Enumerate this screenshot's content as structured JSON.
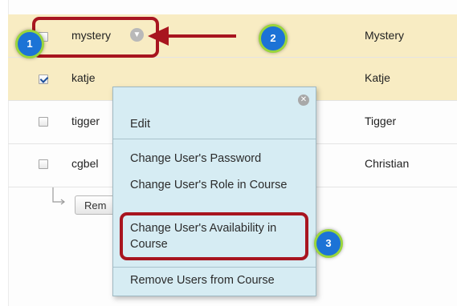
{
  "users": [
    {
      "username": "mystery",
      "first_name": "Mystery",
      "checked": false
    },
    {
      "username": "katje",
      "first_name": "Katje",
      "checked": true
    },
    {
      "username": "tigger",
      "first_name": "Tigger",
      "checked": false
    },
    {
      "username": "cgbel",
      "first_name": "Christian",
      "checked": false
    }
  ],
  "remove_button_label": "Rem",
  "context_menu": {
    "close_icon": "close-icon",
    "items": [
      "Edit",
      "Change User's Password",
      "Change User's Role in Course",
      "Change User's Availability in Course",
      "Remove Users from Course"
    ]
  },
  "callouts": [
    "1",
    "2",
    "3"
  ],
  "colors": {
    "highlight_row": "#f8ecc3",
    "menu_background": "#d6ecf3",
    "callout_outline": "#a8151f",
    "badge_fill": "#1c73d6",
    "badge_ring": "#9ad53c"
  }
}
